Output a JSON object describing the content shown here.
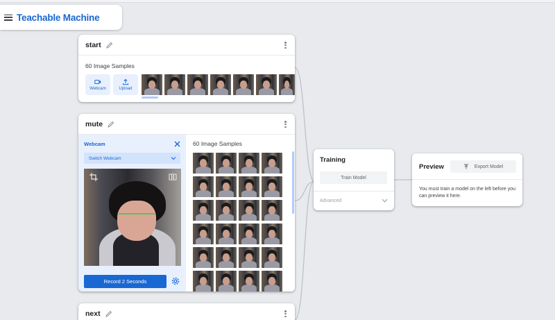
{
  "app": {
    "title": "Teachable Machine"
  },
  "classes": [
    {
      "name": "start",
      "samples_label": "60 Image Samples",
      "buttons": {
        "webcam": "Webcam",
        "upload": "Upload"
      }
    },
    {
      "name": "mute",
      "samples_label": "60 Image Samples",
      "webcam_panel": {
        "title": "Webcam",
        "switch_label": "Switch Webcam",
        "record_label": "Record 2 Seconds"
      }
    },
    {
      "name": "next"
    }
  ],
  "training": {
    "title": "Training",
    "train_button": "Train Model",
    "advanced_label": "Advanced"
  },
  "preview": {
    "title": "Preview",
    "export_button": "Export Model",
    "message": "You must train a model on the left before you can preview it here."
  },
  "colors": {
    "accent": "#1967d2",
    "accent_light": "#e8f0fe",
    "background": "#e8eaed"
  },
  "icons": [
    "menu-icon",
    "pencil-icon",
    "more-vert-icon",
    "videocam-icon",
    "upload-icon",
    "close-icon",
    "chevron-down-icon",
    "crop-icon",
    "flip-icon",
    "settings-icon",
    "export-icon"
  ]
}
